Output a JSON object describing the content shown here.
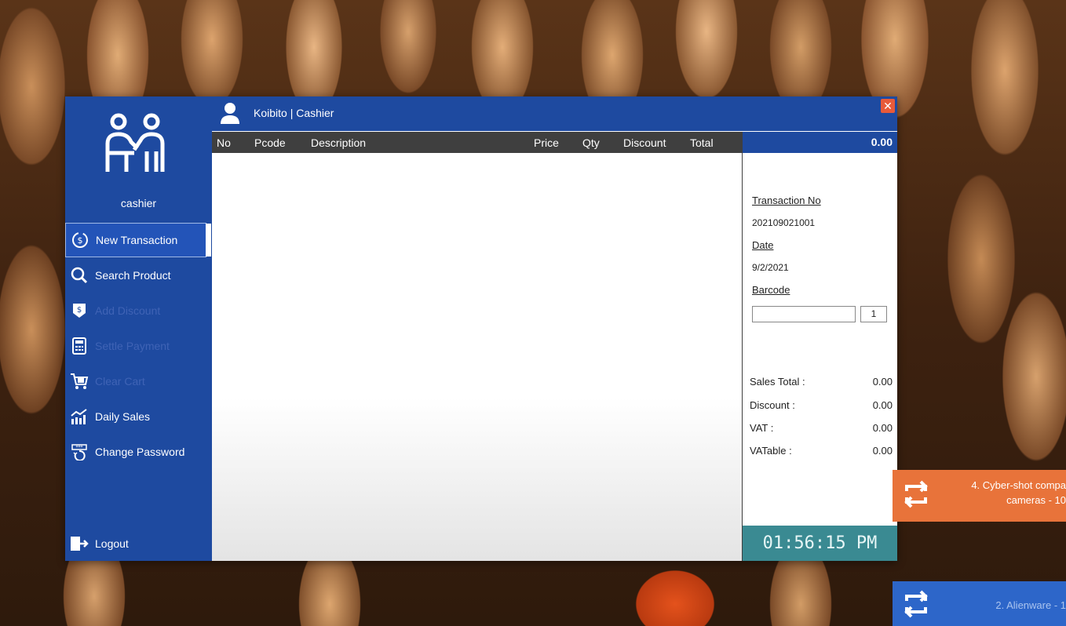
{
  "header": {
    "user": "Koibito | Cashier"
  },
  "sidebar": {
    "role": "cashier",
    "items": [
      {
        "label": "New Transaction"
      },
      {
        "label": "Search Product"
      },
      {
        "label": "Add Discount"
      },
      {
        "label": "Settle Payment"
      },
      {
        "label": "Clear Cart"
      },
      {
        "label": "Daily Sales"
      },
      {
        "label": "Change Password"
      }
    ],
    "logout": "Logout"
  },
  "table": {
    "columns": [
      "No",
      "Pcode",
      "Description",
      "Price",
      "Qty",
      "Discount",
      "Total"
    ]
  },
  "panel": {
    "grand_total": "0.00",
    "transaction_no_label": "Transaction No",
    "transaction_no": "202109021001",
    "date_label": "Date",
    "date": "9/2/2021",
    "barcode_label": "Barcode",
    "barcode_value": "",
    "qty_value": "1",
    "sales_total_label": "Sales Total :",
    "sales_total": "0.00",
    "discount_label": "Discount :",
    "discount": "0.00",
    "vat_label": "VAT :",
    "vat": "0.00",
    "vatable_label": "VATable :",
    "vatable": "0.00"
  },
  "clock": "01:56:15 PM",
  "notifications": [
    {
      "line1": "4. Cyber-shot compa",
      "line2": "cameras - 10"
    },
    {
      "line1": "2. Alienware - 1"
    }
  ],
  "colors": {
    "primary": "#1e4aa0",
    "clock": "#3a8a92",
    "close": "#e85a3a",
    "orange": "#e8733a"
  }
}
